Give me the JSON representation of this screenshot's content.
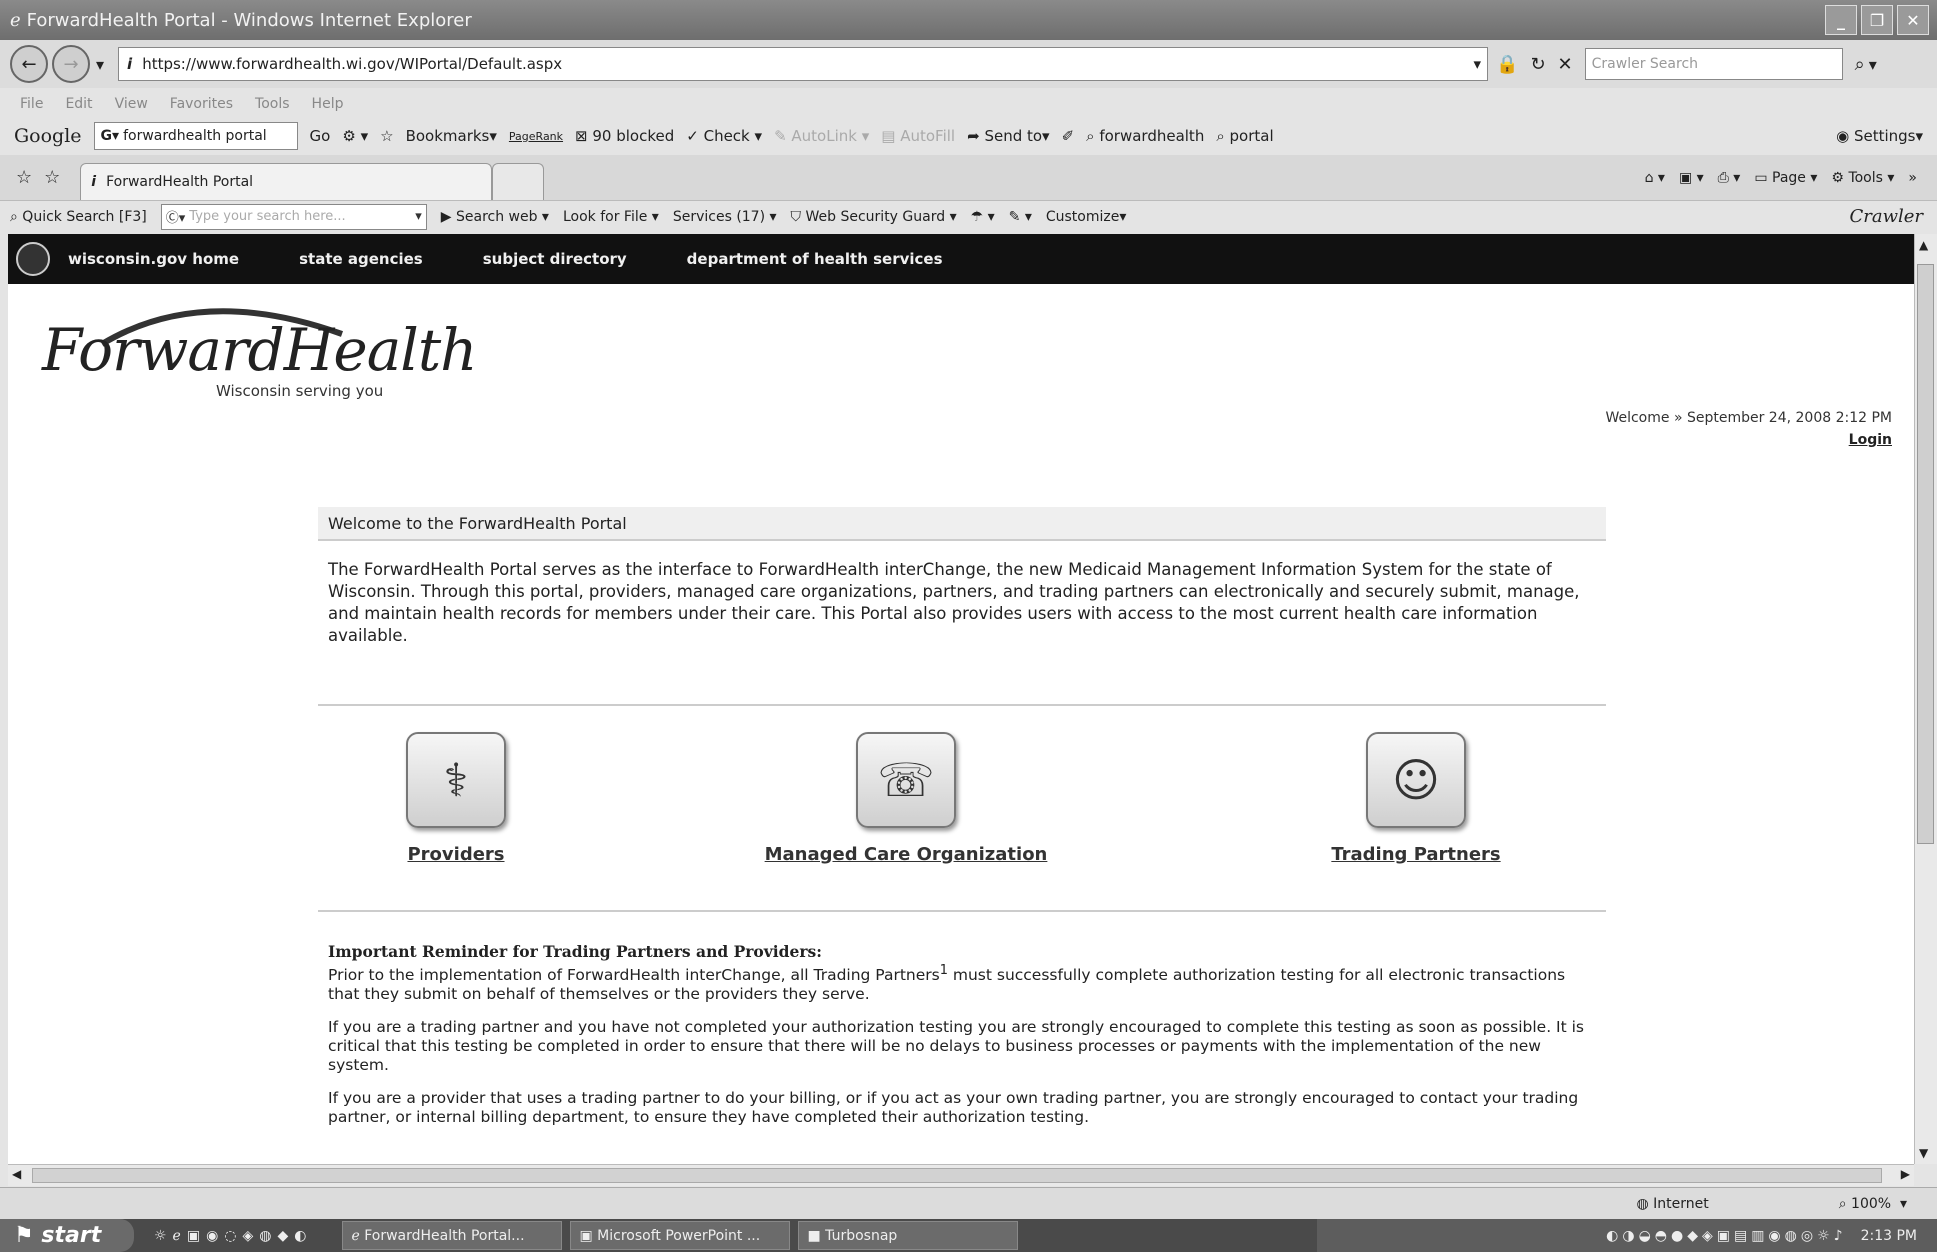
{
  "window": {
    "title": "ForwardHealth Portal - Windows Internet Explorer",
    "controls": [
      "_",
      "❐",
      "✕"
    ]
  },
  "address_bar": {
    "url": "https://www.forwardhealth.wi.gov/WIPortal/Default.aspx",
    "search_placeholder": "Crawler Search"
  },
  "menu": [
    "File",
    "Edit",
    "View",
    "Favorites",
    "Tools",
    "Help"
  ],
  "google_toolbar": {
    "brand": "Google",
    "query": "forwardhealth portal",
    "go": "Go",
    "bookmarks": "Bookmarks▾",
    "pagerank": "PageRank",
    "blocked": "90 blocked",
    "check": "Check",
    "autolink": "AutoLink",
    "autofill": "AutoFill",
    "sendto": "Send to▾",
    "hl1": "forwardhealth",
    "hl2": "portal",
    "settings": "Settings▾"
  },
  "tabs": {
    "active": "ForwardHealth Portal",
    "page": "Page",
    "tools": "Tools"
  },
  "crawler_toolbar": {
    "quick_search": "Quick Search [F3]",
    "search_placeholder": "Type your search here...",
    "search_web": "Search web",
    "look_for_file": "Look for File",
    "services": "Services (17)",
    "security": "Web Security Guard",
    "customize": "Customize",
    "brand": "Crawler"
  },
  "site_nav": [
    "wisconsin.gov home",
    "state agencies",
    "subject directory",
    "department of health services"
  ],
  "logo": {
    "title": "ForwardHealth",
    "tagline": "Wisconsin serving you"
  },
  "header": {
    "welcome": "Welcome",
    "date": "September 24, 2008 2:12 PM",
    "login": "Login"
  },
  "main": {
    "welcome_title": "Welcome to the ForwardHealth Portal",
    "intro": "The ForwardHealth Portal serves as the interface to ForwardHealth interChange, the new Medicaid Management Information System for the state of Wisconsin. Through this portal, providers, managed care organizations, partners, and trading partners can electronically and securely submit, manage, and maintain health records for members under their care. This Portal also provides users with access to the most current health care information available.",
    "roles": [
      {
        "label": "Providers"
      },
      {
        "label": "Managed Care Organization"
      },
      {
        "label": "Trading Partners"
      }
    ],
    "reminder_title": "Important Reminder for Trading Partners and Providers:",
    "reminder_p1a": "Prior to the implementation of ForwardHealth interChange, all Trading Partners",
    "reminder_sup": "1",
    "reminder_p1b": " must successfully complete authorization testing for all electronic transactions that they submit on behalf of themselves or the providers they serve.",
    "reminder_p2": "If you are a trading partner and you have not completed your authorization testing you are strongly encouraged to complete this testing as soon as possible. It is critical that this testing be completed in order to ensure that there will be no delays to business processes or payments with the implementation of the new system.",
    "reminder_p3": "If you are a provider that uses a trading partner to do your billing, or if you act as your own trading partner, you are strongly encouraged to contact your trading partner, or internal billing department, to ensure they have completed their authorization testing."
  },
  "status_bar": {
    "zone": "Internet",
    "zoom": "100%"
  },
  "taskbar": {
    "start": "start",
    "tasks": [
      "ForwardHealth Portal...",
      "Microsoft PowerPoint ...",
      "Turbosnap"
    ],
    "clock": "2:13 PM"
  }
}
